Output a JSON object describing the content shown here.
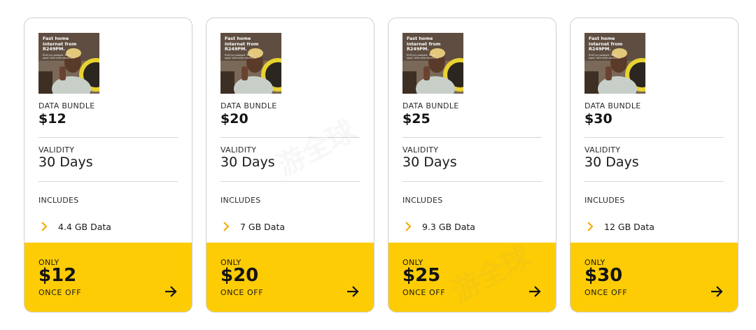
{
  "ad_image": {
    "headline": "Fast home internet from R249PM.",
    "fine_print": "R249 pm postpaid. Ts&Cs apply. Valid while stocks last."
  },
  "labels": {
    "data_bundle": "DATA BUNDLE",
    "validity": "VALIDITY",
    "includes": "INCLUDES",
    "only": "ONLY",
    "once_off": "ONCE OFF"
  },
  "cards": [
    {
      "price": "$12",
      "validity": "30 Days",
      "feature": "4.4 GB Data"
    },
    {
      "price": "$20",
      "validity": "30 Days",
      "feature": "7 GB Data"
    },
    {
      "price": "$25",
      "validity": "30 Days",
      "feature": "9.3 GB Data"
    },
    {
      "price": "$30",
      "validity": "30 Days",
      "feature": "12 GB Data"
    }
  ],
  "colors": {
    "accent_yellow": "#fdcc04",
    "chevron_orange": "#f2a900",
    "border": "#cfcfcf"
  },
  "icons": {
    "feature_bullet": "chevron-right-icon",
    "buy": "arrow-right-icon"
  },
  "watermark": {
    "text": "游全球"
  }
}
